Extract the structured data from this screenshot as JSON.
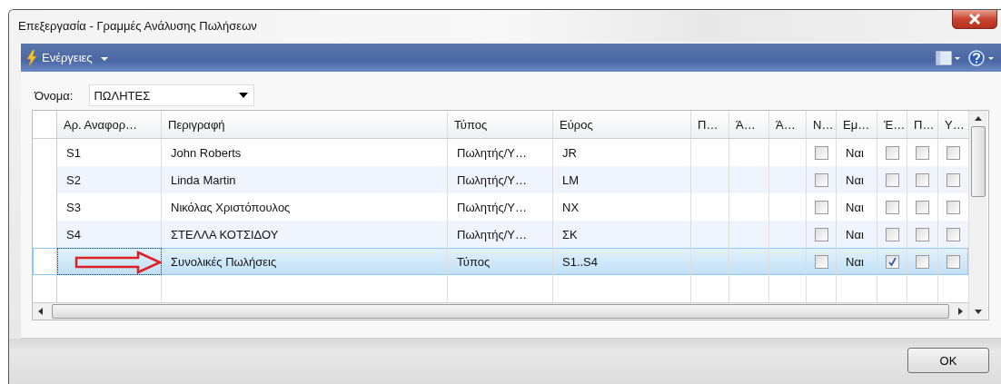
{
  "window": {
    "title": "Επεξεργασία - Γραμμές Ανάλυσης Πωλήσεων"
  },
  "toolbar": {
    "actions_label": "Ενέργειες"
  },
  "name_field": {
    "label": "Όνομα:",
    "value": "ΠΩΛΗΤΕΣ"
  },
  "table": {
    "columns": [
      {
        "label": "Αρ. Αναφορ…",
        "kind": "text"
      },
      {
        "label": "Περιγραφή",
        "kind": "text"
      },
      {
        "label": "Τύπος",
        "kind": "text"
      },
      {
        "label": "Εύρος",
        "kind": "text"
      },
      {
        "label": "Π…",
        "kind": "text"
      },
      {
        "label": "Ά…",
        "kind": "text"
      },
      {
        "label": "Ά…",
        "kind": "text"
      },
      {
        "label": "Ν…",
        "kind": "check"
      },
      {
        "label": "Εμ…",
        "kind": "text"
      },
      {
        "label": "Έ…",
        "kind": "check"
      },
      {
        "label": "Π…",
        "kind": "check"
      },
      {
        "label": "Υ…",
        "kind": "check"
      }
    ],
    "rows": [
      {
        "selected": false,
        "cells": [
          {
            "text": "S1"
          },
          {
            "text": "John Roberts"
          },
          {
            "text": "Πωλητής/Υ…"
          },
          {
            "text": "JR"
          },
          {},
          {},
          {},
          {
            "checked": false
          },
          {
            "text": "Ναι"
          },
          {
            "checked": false
          },
          {
            "checked": false
          },
          {
            "checked": false
          }
        ]
      },
      {
        "selected": false,
        "cells": [
          {
            "text": "S2"
          },
          {
            "text": "Linda Martin"
          },
          {
            "text": "Πωλητής/Υ…"
          },
          {
            "text": "LM"
          },
          {},
          {},
          {},
          {
            "checked": false
          },
          {
            "text": "Ναι"
          },
          {
            "checked": false
          },
          {
            "checked": false
          },
          {
            "checked": false
          }
        ]
      },
      {
        "selected": false,
        "cells": [
          {
            "text": "S3"
          },
          {
            "text": "Νικόλας Χριστόπουλος"
          },
          {
            "text": "Πωλητής/Υ…"
          },
          {
            "text": "NX"
          },
          {},
          {},
          {},
          {
            "checked": false
          },
          {
            "text": "Ναι"
          },
          {
            "checked": false
          },
          {
            "checked": false
          },
          {
            "checked": false
          }
        ]
      },
      {
        "selected": false,
        "cells": [
          {
            "text": "S4"
          },
          {
            "text": "ΣΤΕΛΛΑ ΚΟΤΣΙΔΟΥ"
          },
          {
            "text": "Πωλητής/Υ…"
          },
          {
            "text": "ΣΚ"
          },
          {},
          {},
          {},
          {
            "checked": false
          },
          {
            "text": "Ναι"
          },
          {
            "checked": false
          },
          {
            "checked": false
          },
          {
            "checked": false
          }
        ]
      },
      {
        "selected": true,
        "cells": [
          {},
          {
            "text": "Συνολικές Πωλήσεις"
          },
          {
            "text": "Τύπος"
          },
          {
            "text": "S1..S4"
          },
          {},
          {},
          {},
          {
            "checked": false
          },
          {
            "text": "Ναι"
          },
          {
            "checked": true
          },
          {
            "checked": false
          },
          {
            "checked": false
          }
        ]
      }
    ]
  },
  "buttons": [
    "OK"
  ]
}
